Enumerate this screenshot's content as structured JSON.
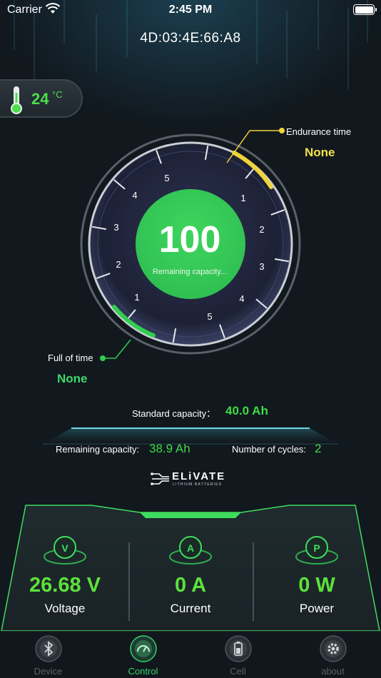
{
  "status_bar": {
    "carrier": "Carrier",
    "time": "2:45 PM"
  },
  "device": {
    "mac": "4D:03:4E:66:A8"
  },
  "temperature": {
    "value": "24",
    "unit": "°C"
  },
  "gauge": {
    "center_value": "100",
    "center_label": "Remaining capacity...",
    "left_ticks": [
      "5",
      "4",
      "3",
      "2",
      "1"
    ],
    "right_ticks": [
      "1",
      "2",
      "3",
      "4",
      "5"
    ],
    "endurance_label": "Endurance time",
    "endurance_value": "None",
    "full_label": "Full of time",
    "full_value": "None"
  },
  "capacity": {
    "standard_label": "Standard capacity：",
    "standard_value": "40.0 Ah",
    "remaining_label": "Remaining capacity:",
    "remaining_value": "38.9 Ah",
    "cycles_label": "Number of cycles:",
    "cycles_value": "2"
  },
  "brand": {
    "name": "ELiVATE",
    "tagline": "LITHIUM BATTERIES"
  },
  "metrics": [
    {
      "icon": "V",
      "value": "26.68 V",
      "label": "Voltage"
    },
    {
      "icon": "A",
      "value": "0 A",
      "label": "Current"
    },
    {
      "icon": "P",
      "value": "0 W",
      "label": "Power"
    }
  ],
  "tabs": [
    {
      "label": "Device",
      "icon": "bluetooth-icon"
    },
    {
      "label": "Control",
      "icon": "dashboard-icon"
    },
    {
      "label": "Cell",
      "icon": "battery-cell-icon"
    },
    {
      "label": "about",
      "icon": "gear-icon"
    }
  ],
  "colors": {
    "accent_green": "#3fdb46",
    "endurance_yellow": "#f3e24a",
    "background": "#11181e"
  }
}
